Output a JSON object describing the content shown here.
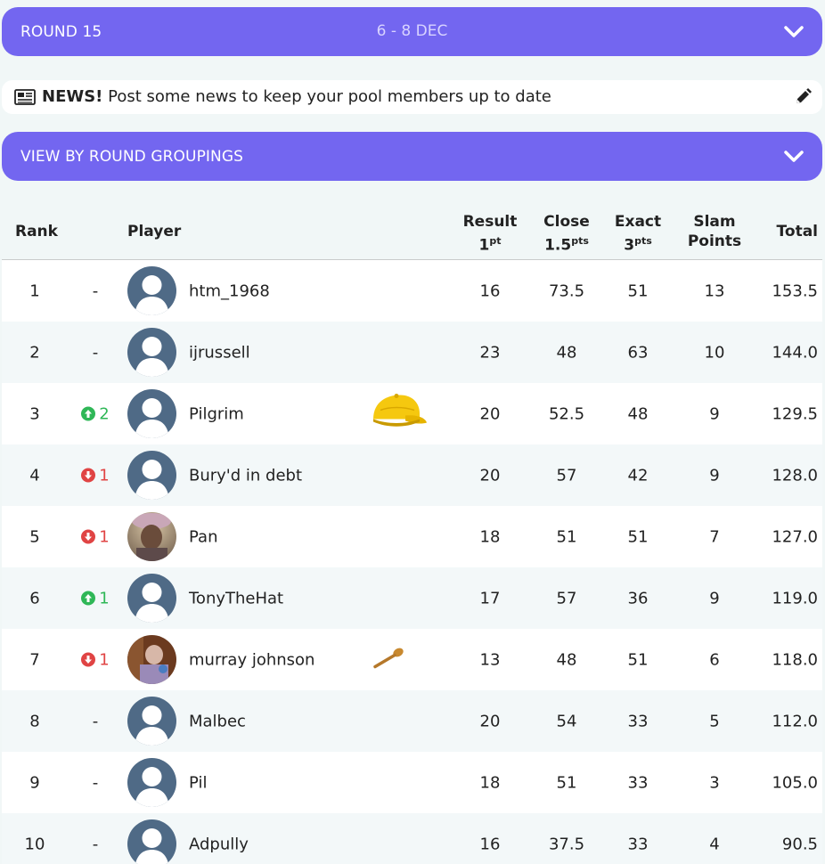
{
  "round_bar": {
    "label": "ROUND 15",
    "dates": "6 - 8 DEC"
  },
  "news": {
    "title": "NEWS!",
    "message": "Post some news to keep your pool members up to date"
  },
  "grouping_bar": {
    "label": "VIEW BY ROUND GROUPINGS"
  },
  "table": {
    "headers": {
      "rank": "Rank",
      "player": "Player",
      "result_line1": "Result",
      "result_pts": "1",
      "result_unit": "pt",
      "close_line1": "Close",
      "close_pts": "1.5",
      "close_unit": "pts",
      "exact_line1": "Exact",
      "exact_pts": "3",
      "exact_unit": "pts",
      "slam_line1": "Slam",
      "slam_line2": "Points",
      "total": "Total"
    },
    "rows": [
      {
        "rank": "1",
        "move": "-",
        "dir": "none",
        "name": "htm_1968",
        "avatar": "default",
        "badge": "",
        "result": "16",
        "close": "73.5",
        "exact": "51",
        "slam": "13",
        "total": "153.5"
      },
      {
        "rank": "2",
        "move": "-",
        "dir": "none",
        "name": "ijrussell",
        "avatar": "default",
        "badge": "",
        "result": "23",
        "close": "48",
        "exact": "63",
        "slam": "10",
        "total": "144.0"
      },
      {
        "rank": "3",
        "move": "2",
        "dir": "up",
        "name": "Pilgrim",
        "avatar": "default",
        "badge": "cap-icon",
        "result": "20",
        "close": "52.5",
        "exact": "48",
        "slam": "9",
        "total": "129.5"
      },
      {
        "rank": "4",
        "move": "1",
        "dir": "down",
        "name": "Bury'd in debt",
        "avatar": "default",
        "badge": "",
        "result": "20",
        "close": "57",
        "exact": "42",
        "slam": "9",
        "total": "128.0"
      },
      {
        "rank": "5",
        "move": "1",
        "dir": "down",
        "name": "Pan",
        "avatar": "photo-pan",
        "badge": "",
        "result": "18",
        "close": "51",
        "exact": "51",
        "slam": "7",
        "total": "127.0"
      },
      {
        "rank": "6",
        "move": "1",
        "dir": "up",
        "name": "TonyTheHat",
        "avatar": "default",
        "badge": "",
        "result": "17",
        "close": "57",
        "exact": "36",
        "slam": "9",
        "total": "119.0"
      },
      {
        "rank": "7",
        "move": "1",
        "dir": "down",
        "name": "murray johnson",
        "avatar": "photo-murray",
        "badge": "spoon-icon",
        "result": "13",
        "close": "48",
        "exact": "51",
        "slam": "6",
        "total": "118.0"
      },
      {
        "rank": "8",
        "move": "-",
        "dir": "none",
        "name": "Malbec",
        "avatar": "default",
        "badge": "",
        "result": "20",
        "close": "54",
        "exact": "33",
        "slam": "5",
        "total": "112.0"
      },
      {
        "rank": "9",
        "move": "-",
        "dir": "none",
        "name": "Pil",
        "avatar": "default",
        "badge": "",
        "result": "18",
        "close": "51",
        "exact": "33",
        "slam": "3",
        "total": "105.0"
      },
      {
        "rank": "10",
        "move": "-",
        "dir": "none",
        "name": "Adpully",
        "avatar": "default",
        "badge": "",
        "result": "16",
        "close": "37.5",
        "exact": "33",
        "slam": "4",
        "total": "90.5"
      }
    ]
  },
  "colors": {
    "accent": "#7366f0",
    "up": "#2fb757",
    "down": "#e04444",
    "avatar_default": "#4f6a86"
  }
}
